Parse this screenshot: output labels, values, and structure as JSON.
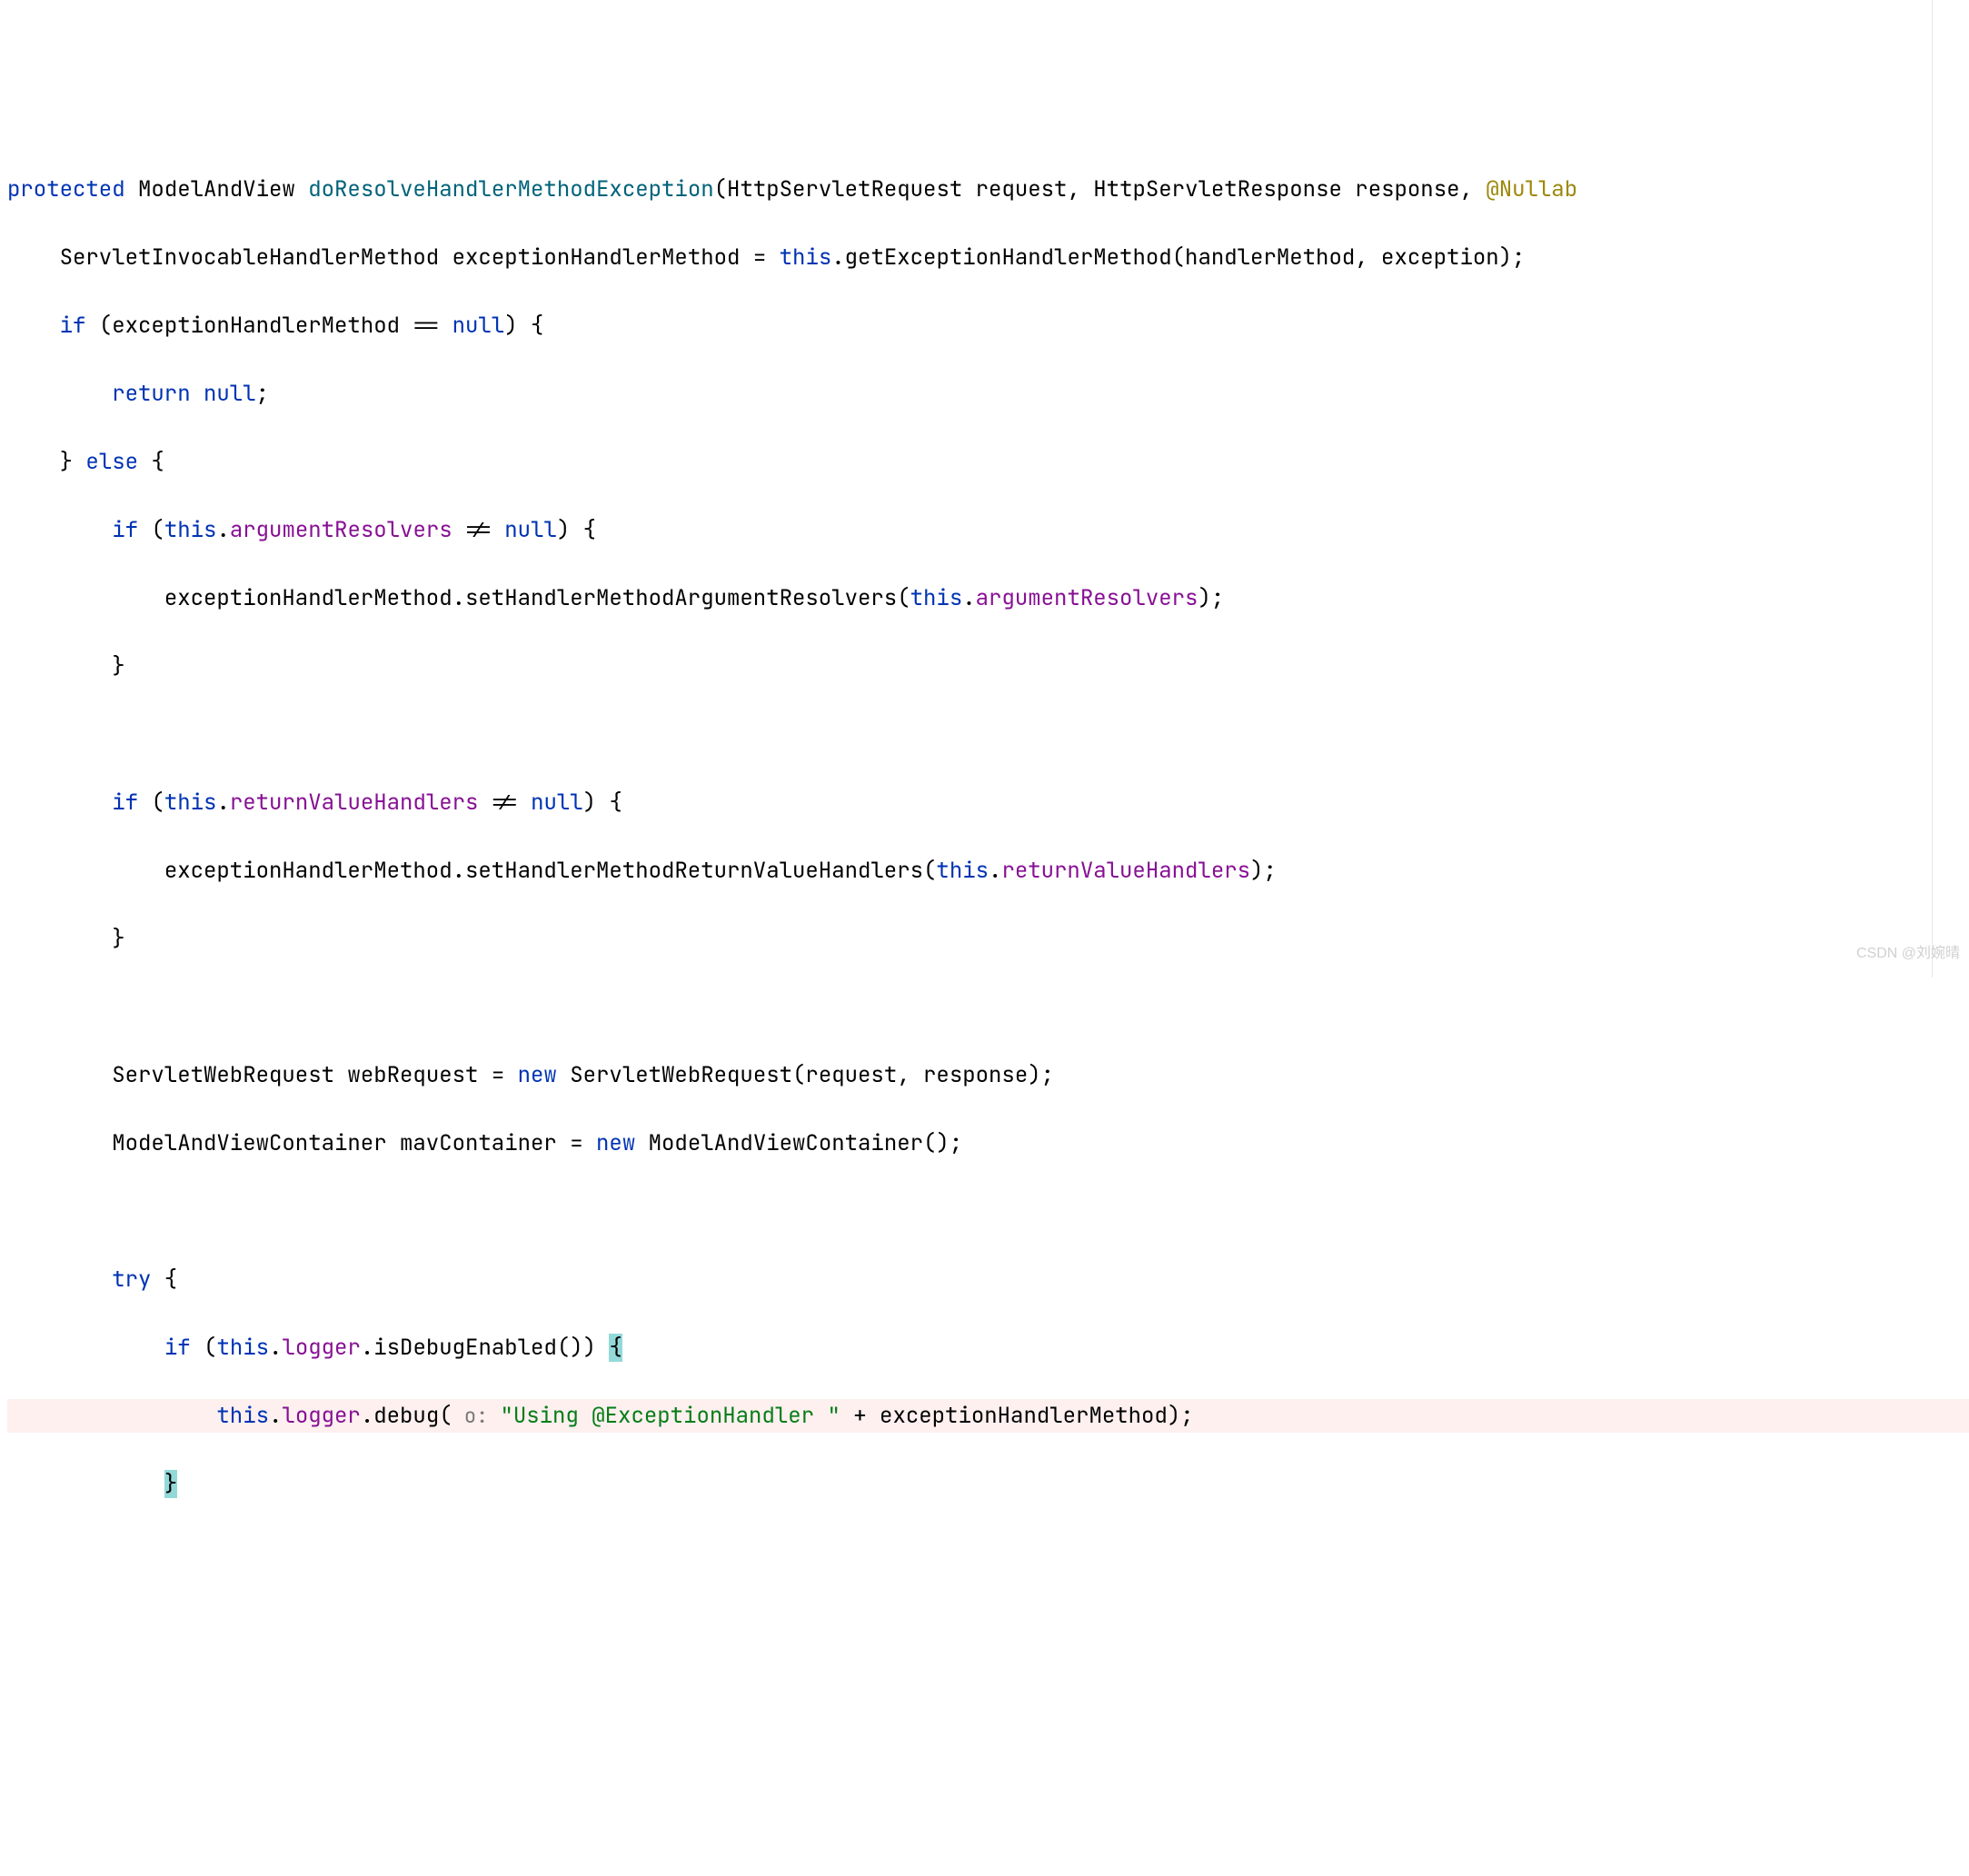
{
  "code": {
    "line1": {
      "protected": "protected",
      "returnType": "ModelAndView",
      "methodName": "doResolveHandlerMethodException",
      "paramOpen": "(",
      "p1Type": "HttpServletRequest",
      "p1Name": "request",
      "comma1": ",",
      "p2Type": "HttpServletResponse",
      "p2Name": "response",
      "comma2": ",",
      "annotation": "@Nullab"
    },
    "line2": {
      "indent": "    ",
      "type": "ServletInvocableHandlerMethod",
      "varName": "exceptionHandlerMethod",
      "eq": " = ",
      "this": "this",
      "dot": ".",
      "call": "getExceptionHandlerMethod",
      "args": "(handlerMethod, exception);"
    },
    "line3": {
      "indent": "    ",
      "if": "if",
      "cond": " (exceptionHandlerMethod == ",
      "null": "null",
      "close": ") {"
    },
    "line4": {
      "indent": "        ",
      "return": "return",
      "null": " null",
      "semi": ";"
    },
    "line5": {
      "indent": "    ",
      "close": "} ",
      "else": "else",
      "open": " {"
    },
    "line6": {
      "indent": "        ",
      "if": "if",
      "open": " (",
      "this": "this",
      "dot": ".",
      "field": "argumentResolvers",
      "neq": " != ",
      "null": "null",
      "close": ") {"
    },
    "line7": {
      "indent": "            ",
      "obj": "exceptionHandlerMethod.setHandlerMethodArgumentResolvers(",
      "this": "this",
      "dot": ".",
      "field": "argumentResolvers",
      "close": ");"
    },
    "line8": {
      "indent": "        ",
      "close": "}"
    },
    "line9": {
      "indent": "        ",
      "if": "if",
      "open": " (",
      "this": "this",
      "dot": ".",
      "field": "returnValueHandlers",
      "neq": " != ",
      "null": "null",
      "close": ") {"
    },
    "line10": {
      "indent": "            ",
      "obj": "exceptionHandlerMethod.setHandlerMethodReturnValueHandlers(",
      "this": "this",
      "dot": ".",
      "field": "returnValueHandlers",
      "close": ");"
    },
    "line11": {
      "indent": "        ",
      "close": "}"
    },
    "line12": {
      "indent": "        ",
      "type": "ServletWebRequest",
      "var": " webRequest = ",
      "new": "new",
      "call": " ServletWebRequest(request, response);"
    },
    "line13": {
      "indent": "        ",
      "type": "ModelAndViewContainer",
      "var": " mavContainer = ",
      "new": "new",
      "call": " ModelAndViewContainer();"
    },
    "line14": {
      "indent": "        ",
      "try": "try",
      "open": " {"
    },
    "line15": {
      "indent": "            ",
      "if": "if",
      "open": " (",
      "this": "this",
      "dot": ".",
      "field": "logger",
      "call": ".isDebugEnabled()) ",
      "brace": "{"
    },
    "line16": {
      "indent": "                ",
      "this": "this",
      "dot": ".",
      "field": "logger",
      "call": ".debug(",
      "hint": " o: ",
      "string": "\"Using @ExceptionHandler \"",
      "plus": " + exceptionHandlerMethod);"
    },
    "line17": {
      "indent": "            ",
      "brace": "}"
    }
  },
  "watermark": "CSDN @刘婉晴"
}
